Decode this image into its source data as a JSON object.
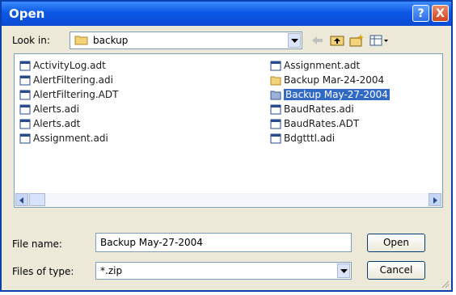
{
  "window": {
    "title": "Open"
  },
  "look_in": {
    "label": "Look in:",
    "value": "backup"
  },
  "file_list": {
    "left_column": [
      "ActivityLog.adt",
      "AlertFiltering.adi",
      "AlertFiltering.ADT",
      "Alerts.adi",
      "Alerts.adt",
      "Assignment.adi"
    ],
    "right_column": [
      "Assignment.adt",
      "Backup Mar-24-2004",
      "Backup May-27-2004",
      "BaudRates.adi",
      "BaudRates.ADT",
      "Bdgtttl.adi"
    ],
    "selected": "Backup May-27-2004"
  },
  "file_name": {
    "label": "File name:",
    "value": "Backup May-27-2004"
  },
  "file_type": {
    "label": "Files of type:",
    "value": "*.zip"
  },
  "buttons": {
    "open": "Open",
    "cancel": "Cancel"
  },
  "title_buttons": {
    "help": "?",
    "close": "X"
  },
  "colors": {
    "title_bar": "#0a4ad4",
    "selection": "#316ac5",
    "dialog_bg": "#ece9d8"
  }
}
